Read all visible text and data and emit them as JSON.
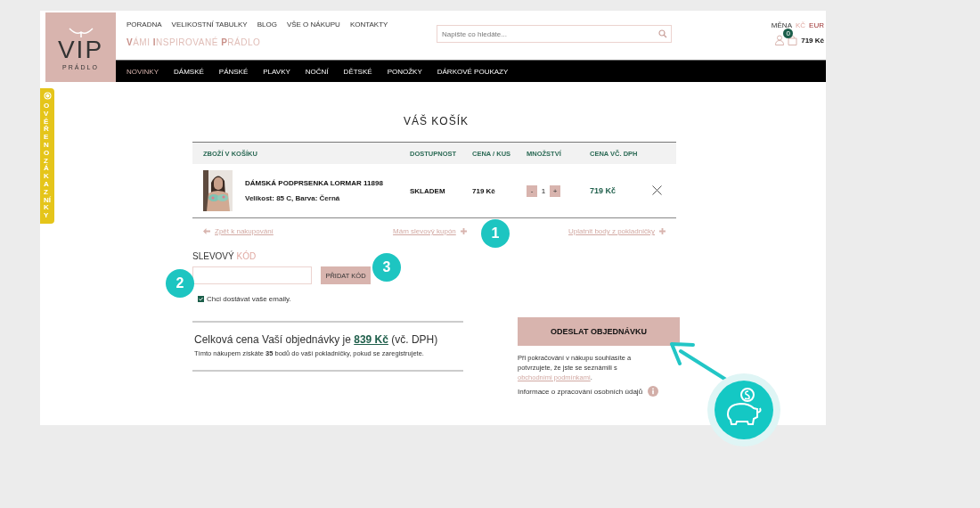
{
  "header": {
    "logo": {
      "mark": "VIP",
      "sub": "PRÁDLO"
    },
    "top_links": [
      "PORADNA",
      "VELIKOSTNÍ TABULKY",
      "BLOG",
      "VŠE O NÁKUPU",
      "KONTAKTY"
    ],
    "tagline": "**V**ÁMI **I**NSPIROVANÉ **P**RÁDLO",
    "search": {
      "placeholder": "Napište co hledáte..."
    },
    "currency": {
      "label": "MĚNA",
      "options": [
        {
          "label": "KČ",
          "selected": true
        },
        {
          "label": "EUR",
          "selected": false
        }
      ]
    },
    "cart": {
      "count": "0",
      "total": "719 Kč"
    }
  },
  "nav": [
    {
      "label": "NOVINKY",
      "selected": true
    },
    {
      "label": "DÁMSKÉ",
      "selected": false
    },
    {
      "label": "PÁNSKÉ",
      "selected": false
    },
    {
      "label": "PLAVKY",
      "selected": false
    },
    {
      "label": "NOČNÍ",
      "selected": false
    },
    {
      "label": "DĚTSKÉ",
      "selected": false
    },
    {
      "label": "PONOŽKY",
      "selected": false
    },
    {
      "label": "DÁRKOVÉ POUKAZY",
      "selected": false
    }
  ],
  "side_tab": "OVĚŘENO ZÁKAZNÍKY",
  "cart_page": {
    "title": "VÁŠ KOŠÍK",
    "table": {
      "columns": [
        "ZBOŽÍ V KOŠÍKU",
        "DOSTUPNOST",
        "CENA / KUS",
        "MNOŽSTVÍ",
        "CENA VČ. DPH"
      ],
      "rows": [
        {
          "name": "DÁMSKÁ PODPRSENKA LORMAR 11898",
          "variant": "Velikost: 85 C, Barva: Černá",
          "availability": "SKLADEM",
          "unit_price": "719 Kč",
          "quantity": {
            "minus": "-",
            "value": "1",
            "plus": "+"
          },
          "price": "719 Kč"
        }
      ]
    },
    "links": [
      {
        "label": "Zpět k nakupování",
        "kind": "back"
      },
      {
        "label": "Mám slevový kupón",
        "kind": "forward"
      },
      {
        "label": "Uplatnit body z pokladničky",
        "kind": "forward"
      }
    ],
    "coupon": {
      "title": "SLEVOVÝ **KÓD**",
      "button": "PŘIDAT KÓD"
    },
    "newsletter": {
      "label": "Chci dostávat vaše emaily.",
      "checked": true
    },
    "total": {
      "text": "Celková cena Vaší objednávky je",
      "amount": "839 Kč",
      "suffix": "(vč. DPH)",
      "note": "Tímto nákupem získáte **35** bodů do vaší pokladničky, pokud se zaregistrujete."
    },
    "submit": "ODESLAT OBJEDNÁVKU",
    "terms": {
      "text": "Při pokračování v nákupu souhlasíte a potvrzujete, že jste se seznámili s",
      "link": "obchodními podmínkami",
      "end": "."
    },
    "privacy": "Informace o zpracování osobních údajů"
  },
  "annotations": [
    {
      "label": "1"
    },
    {
      "label": "2"
    },
    {
      "label": "3"
    }
  ]
}
